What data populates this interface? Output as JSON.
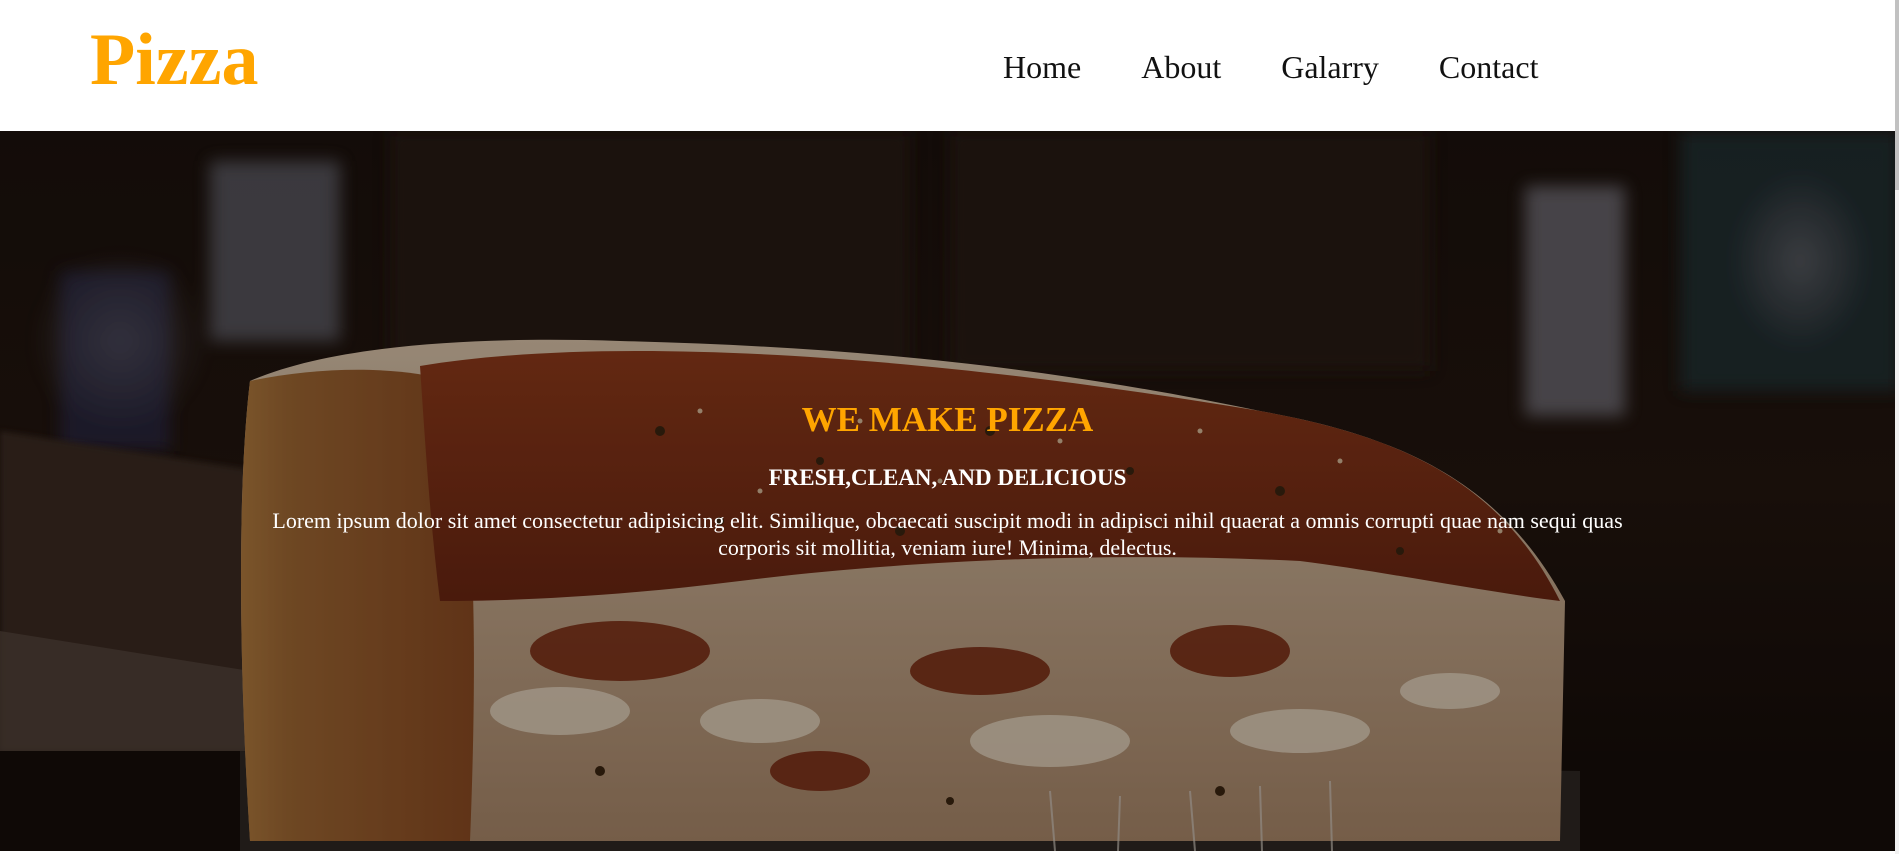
{
  "header": {
    "logo": "Pizza",
    "nav": [
      {
        "label": "Home"
      },
      {
        "label": "About"
      },
      {
        "label": "Galarry"
      },
      {
        "label": "Contact"
      }
    ]
  },
  "hero": {
    "title": "WE MAKE PIZZA",
    "subtitle": "FRESH,CLEAN, AND DELICIOUS",
    "text": "Lorem ipsum dolor sit amet consectetur adipisicing elit. Similique, obcaecati suscipit modi in adipisci nihil quaerat a omnis corrupti quae nam sequi quas corporis sit mollitia, veniam iure! Minima, delectus.",
    "background_image": "pizza-slice-photo"
  },
  "colors": {
    "accent": "#ffa500",
    "nav_text": "#111111",
    "hero_text": "#ffffff",
    "header_bg": "#ffffff"
  }
}
